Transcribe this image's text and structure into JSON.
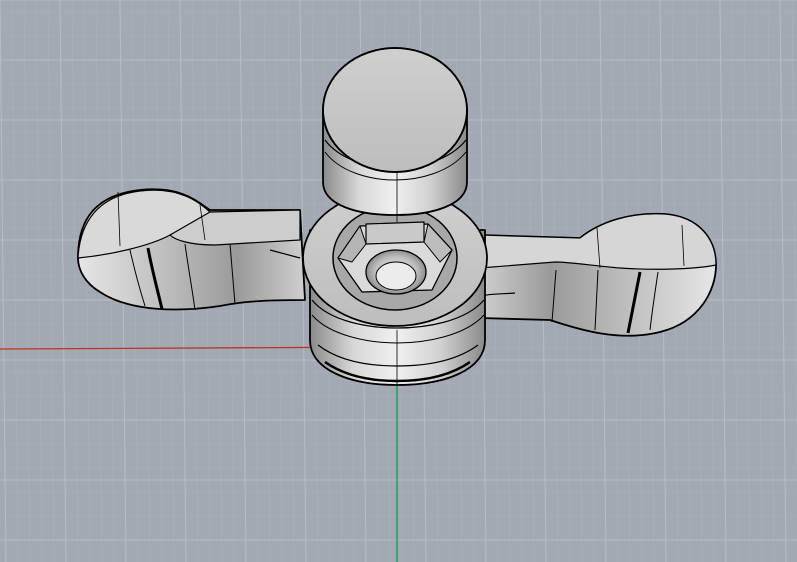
{
  "viewport": {
    "background_color": "#a2a9b2",
    "grid_minor_color": "#aab1ba",
    "grid_major_color": "#b5bcc4",
    "x_axis_color": "#c03028",
    "y_axis_color": "#10a040"
  },
  "model": {
    "fill_color": "#c8c8c8",
    "edge_color": "#000000"
  }
}
